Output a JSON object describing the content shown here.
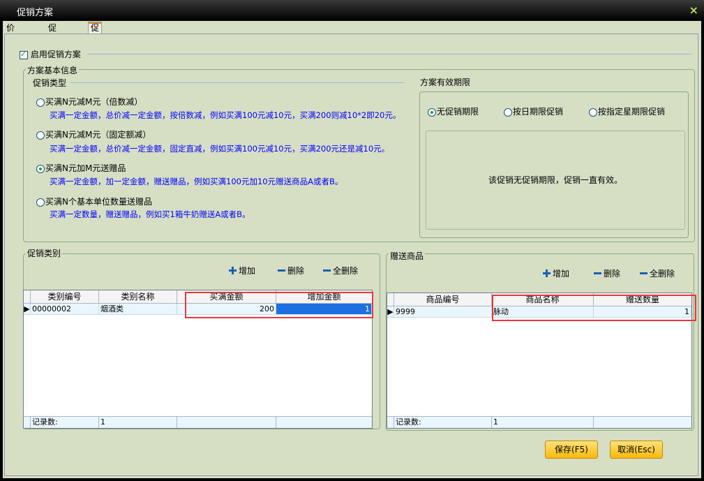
{
  "window": {
    "title": "促销方案",
    "close_glyph": "×"
  },
  "tabs": [
    {
      "label": "价格设置"
    },
    {
      "label": "促销查询"
    },
    {
      "label": "促销方案设置"
    }
  ],
  "enable": {
    "label": "启用促销方案",
    "checked": true
  },
  "basic_info": {
    "title": "方案基本信息",
    "promo_type_title": "促销类型",
    "options": [
      {
        "label": "买满N元减M元（倍数减）",
        "desc": "买满一定金额，总价减一定金额，按倍数减，例如买满100元减10元，买满200则减10*2即20元。",
        "checked": false
      },
      {
        "label": "买满N元减M元（固定额减）",
        "desc": "买满一定金额，总价减一定金额，固定直减，例如买满100元减10元，买满200元还是减10元。",
        "checked": false
      },
      {
        "label": "买满N元加M元送赠品",
        "desc": "买满一定金额，加一定金额，赠送赠品，例如买满100元加10元赠送商品A或者B。",
        "checked": true
      },
      {
        "label": "买满N个基本单位数量送赠品",
        "desc": "买满一定数量，赠送赠品，例如买1箱牛奶赠送A或者B。",
        "checked": false
      }
    ]
  },
  "validity": {
    "title": "方案有效期限",
    "options": [
      {
        "label": "无促销期限",
        "checked": true
      },
      {
        "label": "按日期限促销",
        "checked": false
      },
      {
        "label": "按指定星期限促销",
        "checked": false
      }
    ],
    "message": "该促销无促销期限，促销一直有效。"
  },
  "category": {
    "title": "促销类别",
    "add_label": "增加",
    "delete_label": "删除",
    "delete_all_label": "全删除",
    "columns": [
      "类别编号",
      "类别名称",
      "买满金额",
      "增加金额"
    ],
    "rows": [
      {
        "indicator": "▶",
        "code": "00000002",
        "name": "烟酒类",
        "full_amount": "200",
        "add_amount": "1"
      }
    ],
    "footer_label": "记录数:",
    "footer_count": "1"
  },
  "gift": {
    "title": "赠送商品",
    "add_label": "增加",
    "delete_label": "删除",
    "delete_all_label": "全删除",
    "columns": [
      "商品编号",
      "商品名称",
      "赠送数量"
    ],
    "rows": [
      {
        "indicator": "▶",
        "code": "9999",
        "name": "脉动",
        "qty": "1"
      }
    ],
    "footer_label": "记录数:",
    "footer_count": "1"
  },
  "buttons": {
    "save": "保存(F5)",
    "cancel": "取消(Esc)"
  },
  "colors": {
    "highlight_box": "#e8383d",
    "accent_button": "#f7b80c",
    "selected_cell": "#1e6fe0"
  }
}
